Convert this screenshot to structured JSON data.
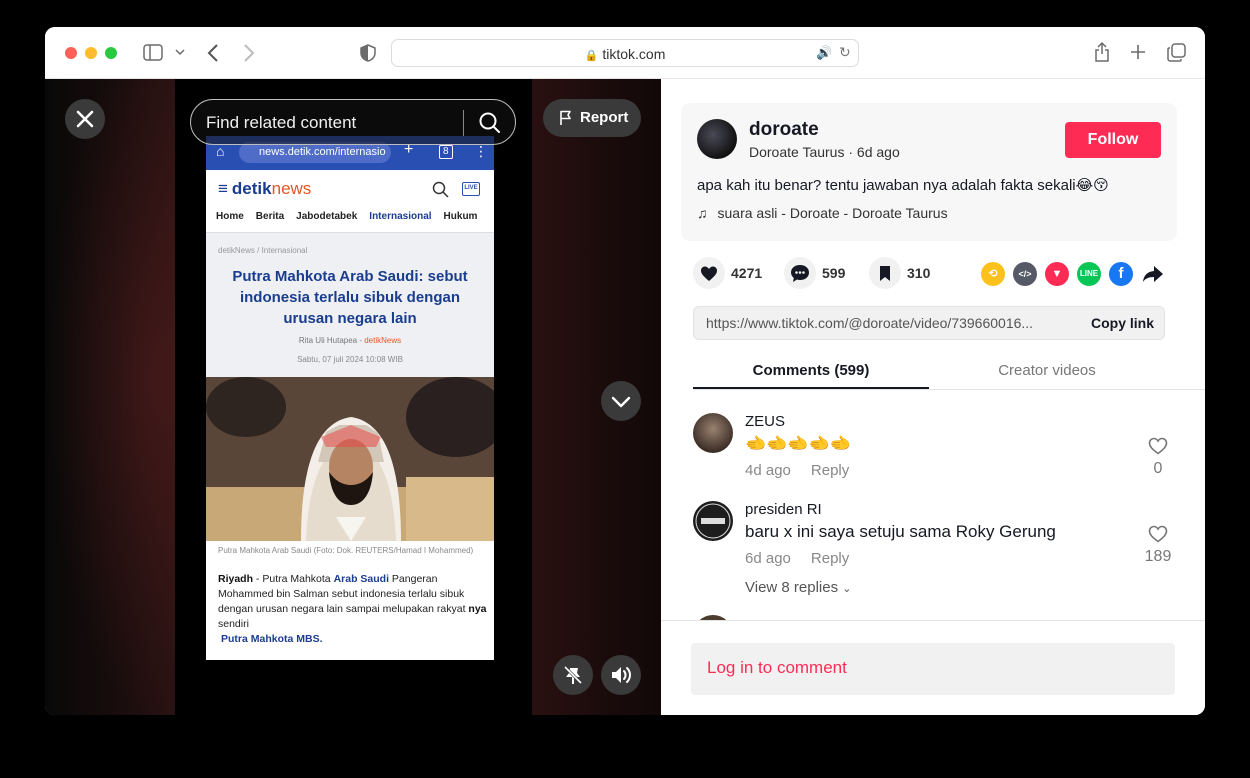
{
  "browser": {
    "url": "tiktok.com",
    "icons": [
      "sidebar-icon",
      "chevron-down-icon",
      "back-icon",
      "forward-icon",
      "shield-icon",
      "lock-icon",
      "speaker-icon",
      "reload-icon",
      "share-icon",
      "plus-icon",
      "tabs-icon"
    ]
  },
  "video": {
    "search_placeholder": "Find related content",
    "report_label": "Report",
    "phone": {
      "url": "news.detik.com/internasio",
      "logo_main": "detik",
      "logo_accent": "news",
      "nav": [
        "Home",
        "Berita",
        "Jabodetabek",
        "Internasional",
        "Hukum"
      ],
      "breadcrumb": "detikNews / Internasional",
      "headline": "Putra Mahkota Arab Saudi: sebut indonesia terlalu sibuk dengan urusan negara lain",
      "author": "Rita Uli Hutapea - ",
      "author_source": "detikNews",
      "date": "Sabtu, 07 juli 2024 10:08 WIB",
      "caption": "Putra Mahkota Arab Saudi (Foto: Dok. REUTERS/Hamad I Mohammed)",
      "article_city": "Riyadh",
      "article_lead": " - Putra Mahkota ",
      "article_link": "Arab Saudi",
      "article_rest": " Pangeran Mohammed bin Salman sebut indonesia terlalu sibuk dengan urusan negara lain sampai melupakan rakyat ",
      "article_bold": "nya",
      "article_end": " sendiri",
      "article_footer_link": "Putra Mahkota MBS."
    }
  },
  "post": {
    "username": "doroate",
    "nickname_line": "Doroate Taurus · 6d ago",
    "follow_label": "Follow",
    "description": "apa kah itu benar? tentu jawaban nya adalah fakta sekali😂😚",
    "music": "suara asli - Doroate - Doroate Taurus",
    "likes": "4271",
    "comments_count": "599",
    "saves": "310",
    "share_targets": [
      "repost-icon",
      "embed-icon",
      "send-icon",
      "line-icon",
      "facebook-icon",
      "share-arrow-icon"
    ],
    "link": "https://www.tiktok.com/@doroate/video/739660016...",
    "copy_label": "Copy link"
  },
  "tabs": {
    "comments": "Comments (599)",
    "creator": "Creator videos"
  },
  "comments": [
    {
      "name": "ZEUS",
      "text": "🫲🫲🫲🫲🫲",
      "age": "4d ago",
      "reply": "Reply",
      "likes": "0"
    },
    {
      "name": "presiden RI",
      "text": "baru x ini saya setuju sama Roky Gerung",
      "age": "6d ago",
      "reply": "Reply",
      "likes": "189",
      "view_replies": "View 8 replies"
    }
  ],
  "login_prompt": "Log in to comment",
  "colors": {
    "accent": "#fe2c55",
    "phone_brand": "#1b3d8f"
  }
}
